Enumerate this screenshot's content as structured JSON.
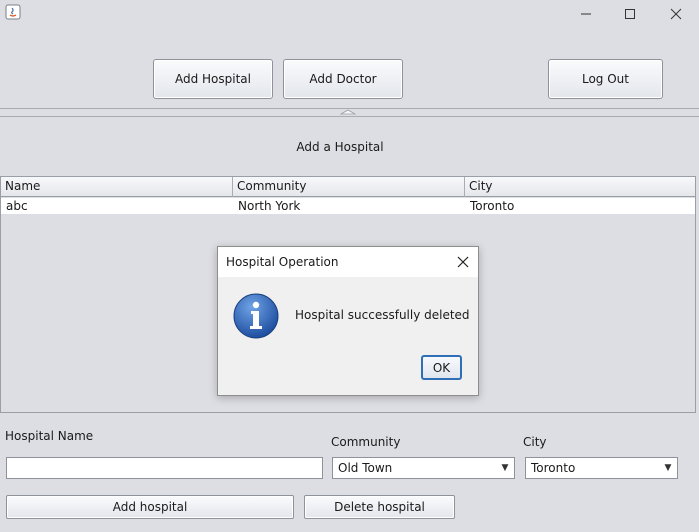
{
  "window": {
    "minimize": "—",
    "maximize": "☐",
    "close": "✕"
  },
  "toolbar": {
    "add_hospital": "Add Hospital",
    "add_doctor": "Add Doctor",
    "log_out": "Log Out"
  },
  "main": {
    "heading": "Add a Hospital"
  },
  "table": {
    "columns": [
      "Name",
      "Community",
      "City"
    ],
    "rows": [
      [
        "abc",
        "North York",
        "Toronto"
      ]
    ]
  },
  "dialog": {
    "title": "Hospital Operation",
    "message": "Hospital successfully deleted",
    "ok": "OK"
  },
  "form": {
    "name_label": "Hospital Name",
    "name_value": "",
    "community_label": "Community",
    "community_value": "Old Town",
    "city_label": "City",
    "city_value": "Toronto",
    "add_button": "Add hospital",
    "delete_button": "Delete hospital"
  }
}
